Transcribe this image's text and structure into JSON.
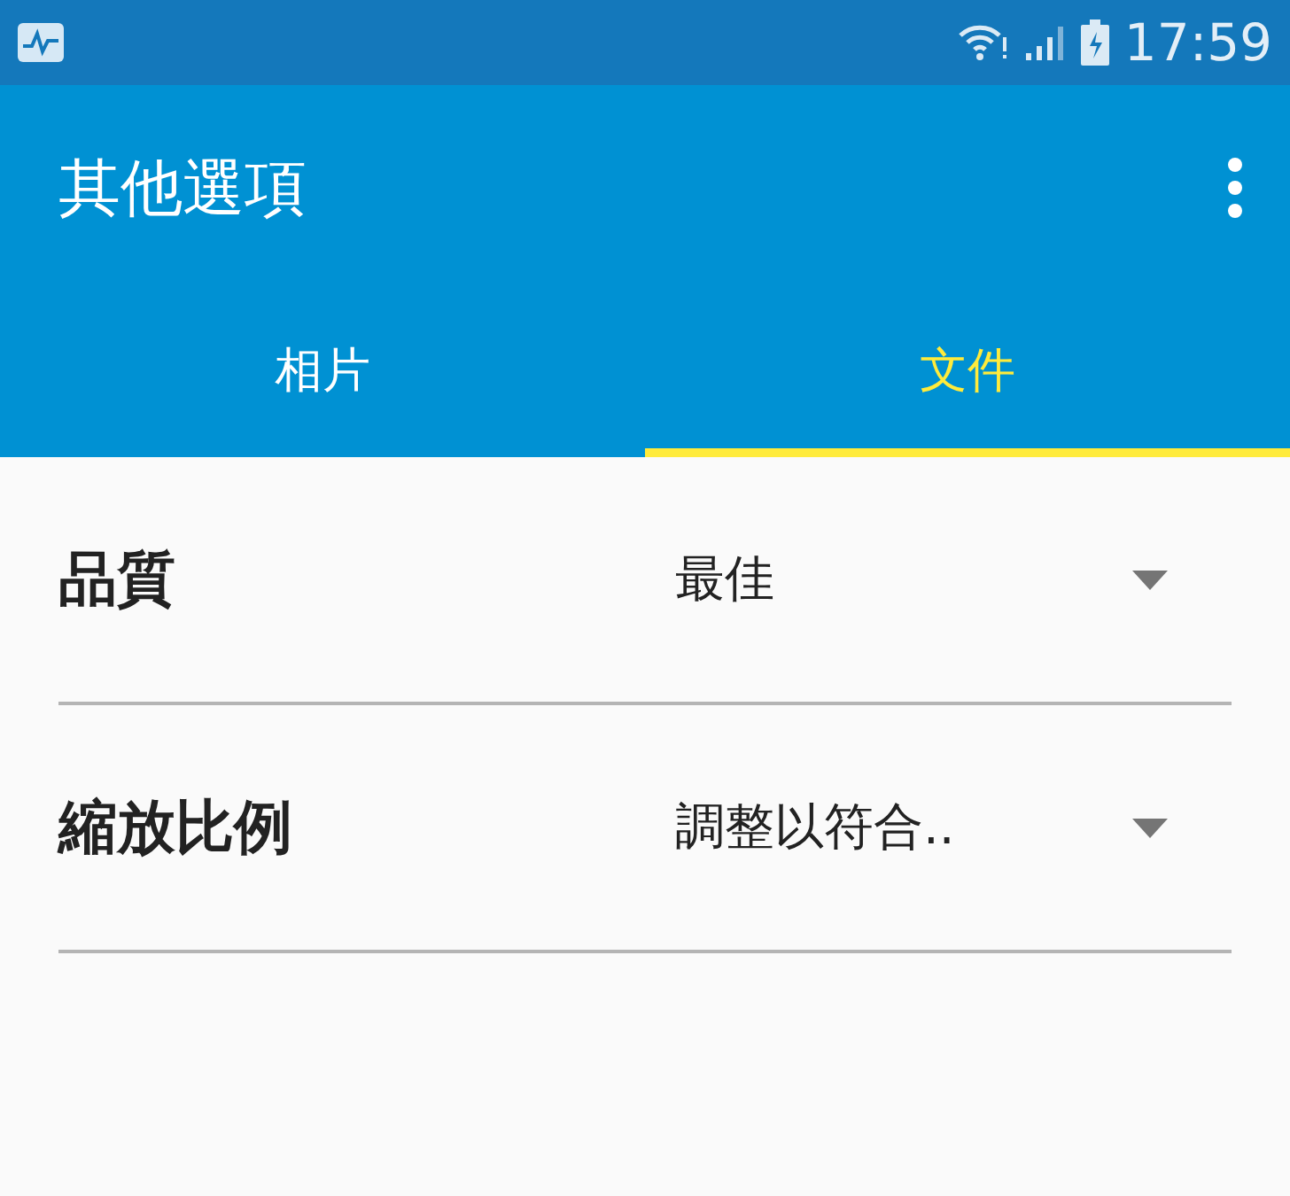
{
  "status_bar": {
    "time": "17:59"
  },
  "app_bar": {
    "title": "其他選項"
  },
  "tabs": [
    {
      "label": "相片",
      "selected": false
    },
    {
      "label": "文件",
      "selected": true
    }
  ],
  "settings": [
    {
      "label": "品質",
      "value": "最佳"
    },
    {
      "label": "縮放比例",
      "value": "調整以符合.."
    }
  ]
}
